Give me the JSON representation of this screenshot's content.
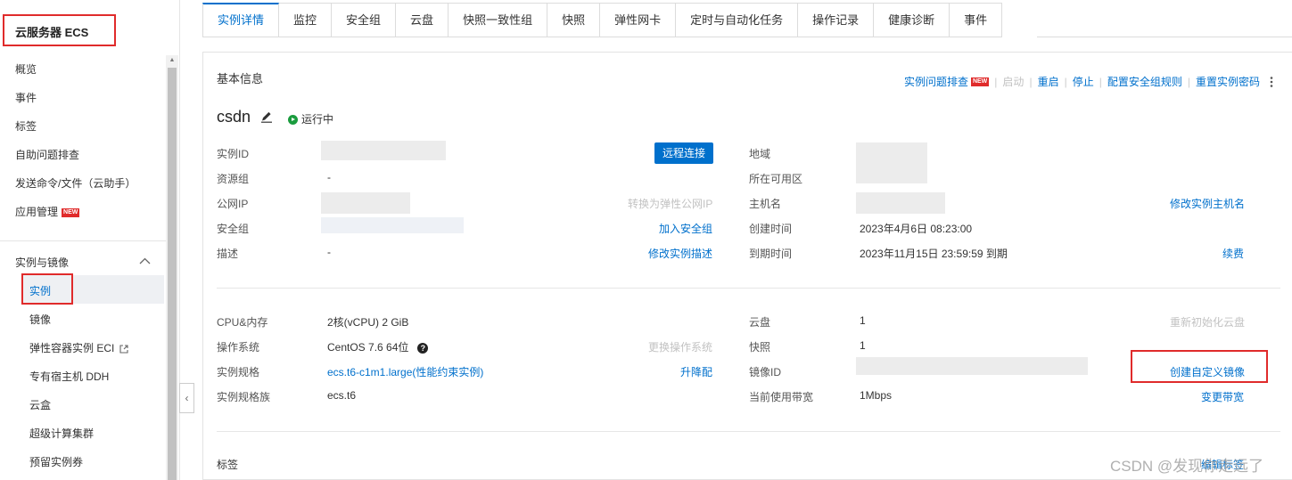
{
  "sidebar": {
    "title": "云服务器 ECS",
    "items": [
      {
        "label": "概览"
      },
      {
        "label": "事件"
      },
      {
        "label": "标签"
      },
      {
        "label": "自助问题排查"
      },
      {
        "label": "发送命令/文件（云助手）"
      },
      {
        "label": "应用管理",
        "badge": "NEW"
      }
    ],
    "group": {
      "label": "实例与镜像",
      "expanded": true
    },
    "sub_items": [
      {
        "label": "实例",
        "active": true
      },
      {
        "label": "镜像"
      },
      {
        "label": "弹性容器实例 ECI",
        "icon": "external-link-icon"
      },
      {
        "label": "专有宿主机 DDH"
      },
      {
        "label": "云盒"
      },
      {
        "label": "超级计算集群"
      },
      {
        "label": "预留实例券"
      }
    ]
  },
  "tabs": [
    {
      "label": "实例详情",
      "active": true
    },
    {
      "label": "监控"
    },
    {
      "label": "安全组"
    },
    {
      "label": "云盘"
    },
    {
      "label": "快照一致性组"
    },
    {
      "label": "快照"
    },
    {
      "label": "弹性网卡"
    },
    {
      "label": "定时与自动化任务"
    },
    {
      "label": "操作记录"
    },
    {
      "label": "健康诊断"
    },
    {
      "label": "事件"
    }
  ],
  "basic_info": {
    "title": "基本信息",
    "toolbar": {
      "troubleshoot": "实例问题排查",
      "troubleshoot_badge": "NEW",
      "start": "启动",
      "restart": "重启",
      "stop": "停止",
      "config_sg": "配置安全组规则",
      "reset_pwd": "重置实例密码"
    },
    "instance_name": "csdn",
    "status": "运行中",
    "remote_connect": "远程连接",
    "left": {
      "instance_id": {
        "label": "实例ID"
      },
      "resource_group": {
        "label": "资源组",
        "value": "-"
      },
      "public_ip": {
        "label": "公网IP",
        "action": "转换为弹性公网IP"
      },
      "security_group": {
        "label": "安全组",
        "action": "加入安全组"
      },
      "description": {
        "label": "描述",
        "value": "-",
        "action": "修改实例描述"
      }
    },
    "right": {
      "region": {
        "label": "地域"
      },
      "zone": {
        "label": "所在可用区"
      },
      "hostname": {
        "label": "主机名",
        "action": "修改实例主机名"
      },
      "created": {
        "label": "创建时间",
        "value": "2023年4月6日 08:23:00"
      },
      "expires": {
        "label": "到期时间",
        "value": "2023年11月15日 23:59:59 到期",
        "action": "续费"
      }
    }
  },
  "config": {
    "cpu_mem": {
      "label": "CPU&内存",
      "value": "2核(vCPU) 2 GiB"
    },
    "os": {
      "label": "操作系统",
      "value": "CentOS 7.6 64位",
      "action": "更换操作系统"
    },
    "spec": {
      "label": "实例规格",
      "value": "ecs.t6-c1m1.large(性能约束实例)",
      "action": "升降配"
    },
    "family": {
      "label": "实例规格族",
      "value": "ecs.t6"
    },
    "disk": {
      "label": "云盘",
      "value": "1",
      "action": "重新初始化云盘"
    },
    "snapshot": {
      "label": "快照",
      "value": "1"
    },
    "image_id": {
      "label": "镜像ID",
      "action": "创建自定义镜像"
    },
    "bandwidth": {
      "label": "当前使用带宽",
      "value": "1Mbps",
      "action": "变更带宽"
    }
  },
  "tags": {
    "title": "标签",
    "action": "编辑标签"
  },
  "watermark": "CSDN @发现你走远了"
}
